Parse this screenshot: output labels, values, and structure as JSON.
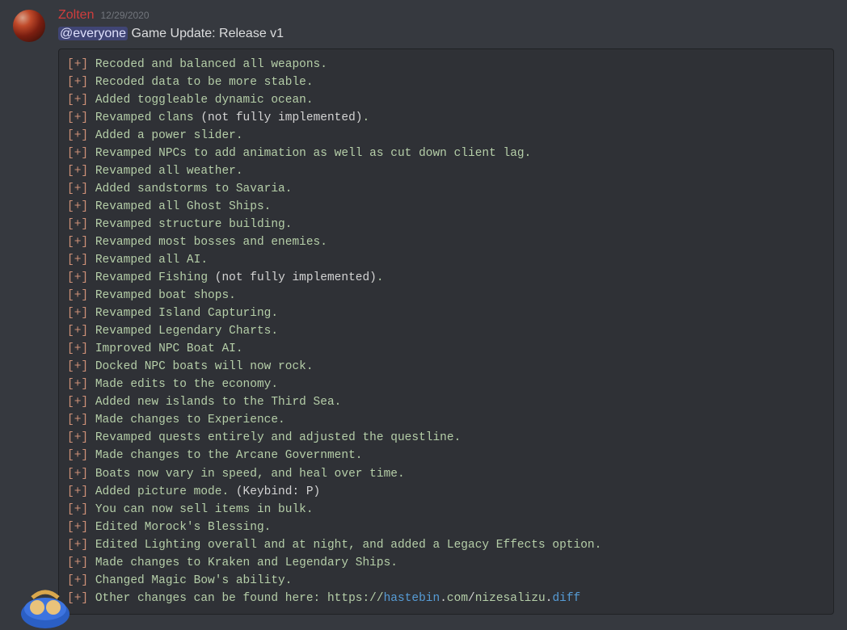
{
  "message": {
    "username": "Zolten",
    "timestamp": "12/29/2020",
    "mention": "@everyone",
    "body_text": " Game Update: Release v1"
  },
  "prefix": "[+]",
  "changelog": [
    "Recoded and balanced all weapons.",
    "Recoded data to be more stable.",
    "Added toggleable dynamic ocean.",
    "Revamped clans (not fully implemented).",
    "Added a power slider.",
    "Revamped NPCs to add animation as well as cut down client lag.",
    "Revamped all weather.",
    "Added sandstorms to Savaria.",
    "Revamped all Ghost Ships.",
    "Revamped structure building.",
    "Revamped most bosses and enemies.",
    "Revamped all AI.",
    "Revamped Fishing (not fully implemented).",
    "Revamped boat shops.",
    "Revamped Island Capturing.",
    "Revamped Legendary Charts.",
    "Improved NPC Boat AI.",
    "Docked NPC boats will now rock.",
    "Made edits to the economy.",
    "Added new islands to the Third Sea.",
    "Made changes to Experience.",
    "Revamped quests entirely and adjusted the questline.",
    "Made changes to the Arcane Government.",
    "Boats now vary in speed, and heal over time.",
    "Added picture mode. (Keybind: P)",
    "You can now sell items in bulk.",
    "Edited Morock's Blessing.",
    "Edited Lighting overall and at night, and added a Legacy Effects option.",
    "Made changes to Kraken and Legendary Ships.",
    "Changed Magic Bow's ability."
  ],
  "final_line": {
    "text_before_url": "Other changes can be found here: ",
    "url": {
      "proto": "https://",
      "host": "hastebin",
      "dot1": ".",
      "tld": "com",
      "slash": "/",
      "path": "nizesalizu",
      "dot2": ".",
      "ext": "diff"
    }
  }
}
